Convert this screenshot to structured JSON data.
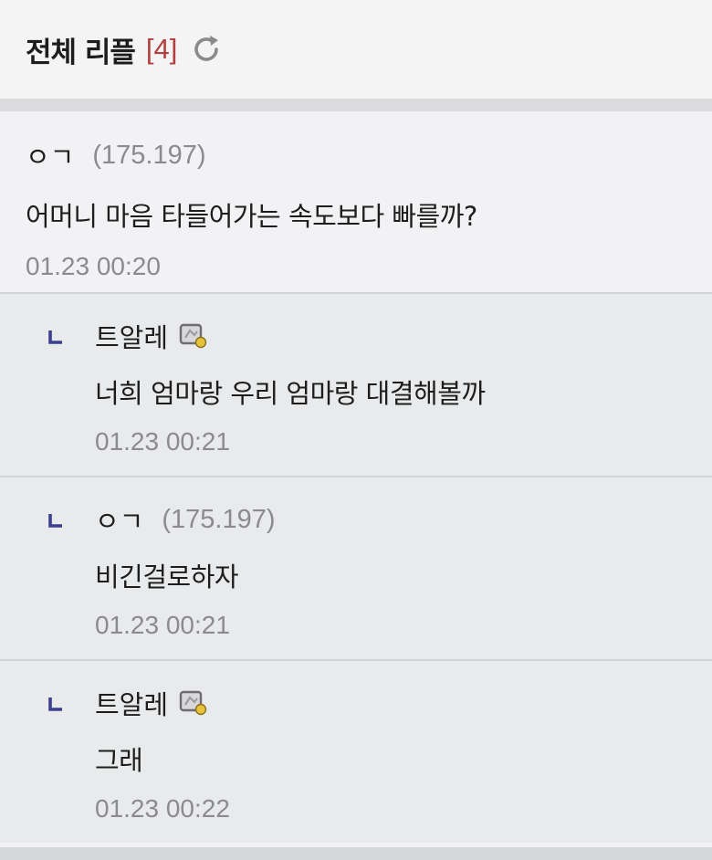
{
  "header": {
    "title": "전체 리플",
    "count": "[4]"
  },
  "comments": [
    {
      "author": "ㅇㄱ",
      "ip": "(175.197)",
      "text": "어머니 마음 타들어가는 속도보다 빠를까?",
      "time": "01.23 00:20"
    }
  ],
  "replies": [
    {
      "author": "트알레",
      "ip": "",
      "text": "너희 엄마랑 우리 엄마랑 대결해볼까",
      "time": "01.23 00:21",
      "badge": "member-badge-icon"
    },
    {
      "author": "ㅇㄱ",
      "ip": "(175.197)",
      "text": "비긴걸로하자",
      "time": "01.23 00:21"
    },
    {
      "author": "트알레",
      "ip": "",
      "text": "그래",
      "time": "01.23 00:22",
      "badge": "member-badge-icon"
    }
  ],
  "colors": {
    "count": "#b0413e",
    "reply_arrow": "#3b3f8f",
    "meta": "#8b8b8e"
  }
}
